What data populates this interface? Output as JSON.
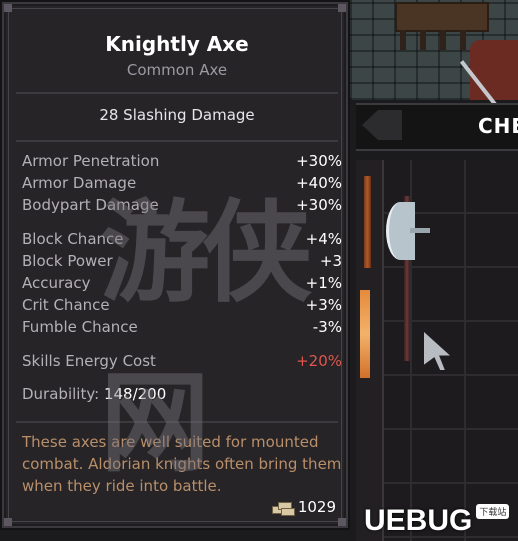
{
  "item": {
    "name": "Knightly Axe",
    "type": "Common Axe",
    "damage": "28 Slashing Damage"
  },
  "stats_group_1": [
    {
      "label": "Armor Penetration",
      "value": "+30%"
    },
    {
      "label": "Armor Damage",
      "value": "+40%"
    },
    {
      "label": "Bodypart Damage",
      "value": "+30%"
    }
  ],
  "stats_group_2": [
    {
      "label": "Block Chance",
      "value": "+4%"
    },
    {
      "label": "Block Power",
      "value": "+3"
    },
    {
      "label": "Accuracy",
      "value": "+1%"
    },
    {
      "label": "Crit Chance",
      "value": "+3%"
    },
    {
      "label": "Fumble Chance",
      "value": "-3%"
    }
  ],
  "stats_group_3": [
    {
      "label": "Skills Energy Cost",
      "value": "+20%"
    }
  ],
  "durability": {
    "label": "Durability:",
    "value": "148/200"
  },
  "description": [
    "These axes are well suited for mounted",
    "combat. Aldorian knights often bring them",
    "when they ride into battle."
  ],
  "price": "1029",
  "background": {
    "panel_title": "CHE"
  },
  "overlay": {
    "watermark_scribble": "游侠网",
    "watermark_logo": "UEBUG",
    "watermark_badge": "下载站"
  },
  "colors": {
    "panel_bg": "#262427",
    "label": "#b4b0b7",
    "value": "#ffffff",
    "negative": "#e0564e",
    "description": "#b98f6a"
  },
  "icons": {
    "price": "coin-stack-icon",
    "cursor": "pointer-cursor-icon"
  }
}
